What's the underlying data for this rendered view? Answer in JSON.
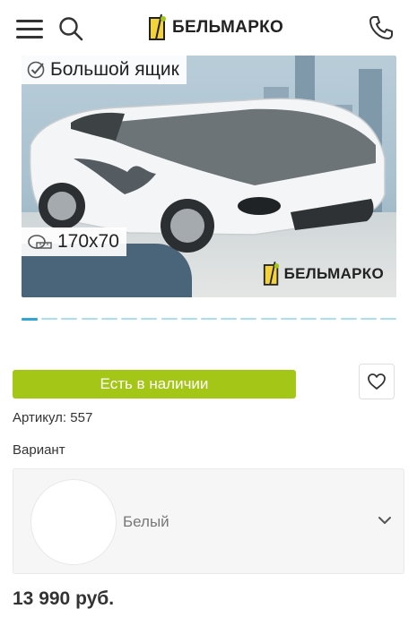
{
  "header": {
    "menu_icon": "hamburger-menu-icon",
    "search_icon": "search-icon",
    "logo_text": "БЕЛЬМАРКО",
    "phone_icon": "phone-icon"
  },
  "slider": {
    "badge_feature": "Большой ящик",
    "badge_size": "170х70",
    "watermark_text": "БЕЛЬМАРКО",
    "dot_count": 19,
    "active_dot": 1
  },
  "product": {
    "stock_label": "Есть в наличии",
    "favorite_icon": "heart-icon",
    "sku_text": "Артикул: 557",
    "variant_label": "Вариант",
    "variant_value": "Белый",
    "price": "13 990 руб."
  },
  "colors": {
    "accent_green": "#a3c617",
    "slider_dot": "#a9dff3",
    "slider_dot_active": "#33a4d6"
  }
}
